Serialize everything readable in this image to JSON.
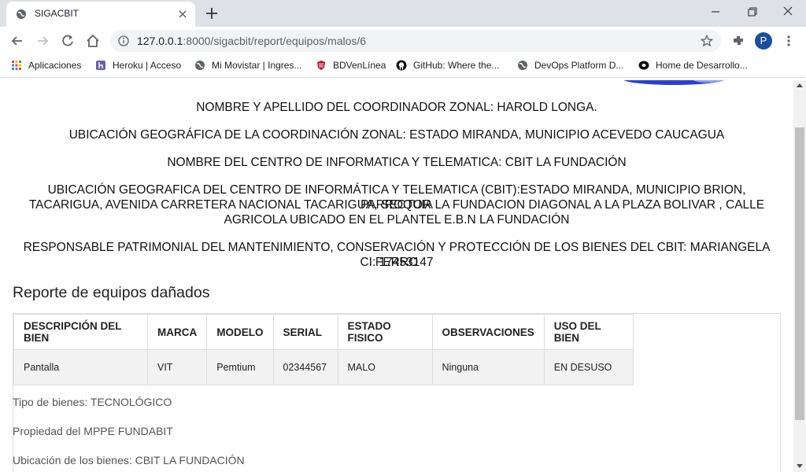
{
  "browser": {
    "tab_title": "SIGACBIT",
    "url_host": "127.0.0.1",
    "url_rest": ":8000/sigacbit/report/equipos/malos/6",
    "profile_initial": "P",
    "bookmarks": [
      {
        "label": "Aplicaciones",
        "icon": "apps-grid-icon"
      },
      {
        "label": "Heroku | Acceso",
        "icon": "heroku-icon"
      },
      {
        "label": "Mi Movistar | Ingres...",
        "icon": "globe-icon"
      },
      {
        "label": "BDVenLínea",
        "icon": "bdv-icon"
      },
      {
        "label": "GitHub: Where the...",
        "icon": "github-icon"
      },
      {
        "label": "DevOps Platform D...",
        "icon": "globe-icon"
      },
      {
        "label": "Home de Desarrollo...",
        "icon": "dev-icon"
      }
    ]
  },
  "report": {
    "coordinador": "NOMBRE Y APELLIDO DEL COORDINADOR ZONAL: HAROLD LONGA.",
    "ubicacion_zonal": "UBICACIÓN GEOGRÁFICA DE LA COORDINACIÓN ZONAL: ESTADO MIRANDA, MUNICIPIO ACEVEDO CAUCAGUA",
    "centro": "NOMBRE DEL CENTRO DE INFORMATICA Y TELEMATICA: CBIT LA FUNDACIÓN",
    "ubicacion_centro_1": "UBICACIÓN GEOGRAFICA DEL CENTRO DE INFORMÁTICA Y TELEMATICA (CBIT):ESTADO MIRANDA, MUNICIPIO BRION, PARROQUIA",
    "ubicacion_centro_2": "TACARIGUA, AVENIDA CARRETERA NACIONAL TACARIGUA, SECTOR LA FUNDACION DIAGONAL A LA PLAZA BOLIVAR , CALLE",
    "ubicacion_centro_3": "AGRICOLA UBICADO EN EL PLANTEL E.B.N LA FUNDACIÓN",
    "responsable_1": "RESPONSABLE PATRIMONIAL DEL MANTENIMIENTO, CONSERVACIÓN Y PROTECCIÓN DE LOS BIENES DEL CBIT: MARIANGELA FERRO",
    "responsable_2": "CI: 17453147",
    "section_title": "Reporte de equipos dañados",
    "table": {
      "headers": [
        "DESCRIPCIÓN DEL BIEN",
        "MARCA",
        "MODELO",
        "SERIAL",
        "ESTADO FISICO",
        "OBSERVACIONES",
        "USO DEL BIEN"
      ],
      "rows": [
        [
          "Pantalla",
          "VIT",
          "Pemtium",
          "02344567",
          "MALO",
          "Ninguna",
          "EN DESUSO"
        ]
      ]
    },
    "tipo_bienes": "Tipo de bienes: TECNOLÓGICO",
    "propiedad": "Propiedad del MPPE FUNDABIT",
    "ubicacion_bienes": "Ubicación de los bienes: CBIT LA FUNDACIÓN"
  }
}
